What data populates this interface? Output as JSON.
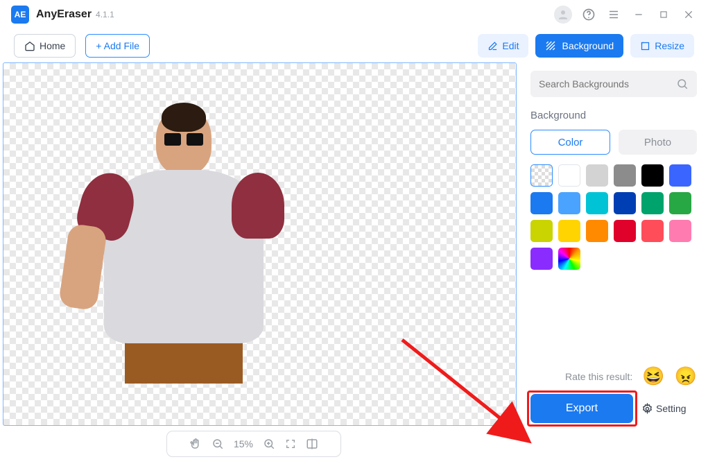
{
  "app": {
    "logo_text": "AE",
    "name": "AnyEraser",
    "version": "4.1.1"
  },
  "toolbar": {
    "home": "Home",
    "add_file": "+ Add File",
    "edit": "Edit",
    "background": "Background",
    "resize": "Resize"
  },
  "panel": {
    "search_placeholder": "Search Backgrounds",
    "section_title": "Background",
    "tab_color": "Color",
    "tab_photo": "Photo",
    "colors": [
      "transparent",
      "#ffffff",
      "#d3d3d3",
      "#8c8c8c",
      "#000000",
      "#3a66ff",
      "#1b7af0",
      "#4aa3ff",
      "#00c4d6",
      "#003fb3",
      "#00a36c",
      "#28a745",
      "#c9d400",
      "#ffd400",
      "#ff8a00",
      "#e0022b",
      "#ff4d5a",
      "#ff7bb0",
      "#8a2cff",
      "rainbow"
    ]
  },
  "rate": {
    "label": "Rate this result:",
    "happy": "😆",
    "angry": "😠"
  },
  "actions": {
    "export": "Export",
    "setting": "Setting"
  },
  "canvas": {
    "zoom": "15%"
  }
}
